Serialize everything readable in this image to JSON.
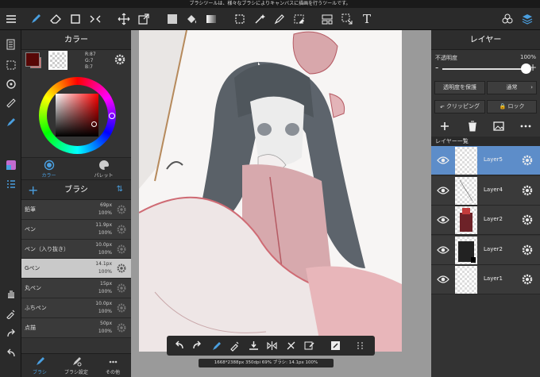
{
  "status": {
    "message": "ブラシツールは、様々なブラシによりキャンバスに描画を行うツールです。"
  },
  "toolbar": {
    "left_icons": [
      "menu-icon",
      "brush-icon",
      "eraser-icon",
      "rect-icon",
      "transform-icon"
    ],
    "mid_icons": [
      "move-icon",
      "resize-icon",
      "fill-color-icon",
      "bucket-icon",
      "gradient-icon",
      "select-rect-icon",
      "magic-wand-icon",
      "select-pen-icon",
      "select-eraser-icon",
      "ruler-icon",
      "select-move-icon",
      "text-icon"
    ],
    "right_icons": [
      "material-icon",
      "layer-stack-icon"
    ],
    "text_tool_glyph": "T"
  },
  "color_panel": {
    "title": "カラー",
    "main_color": "#570706",
    "rgb": {
      "r": "R:87",
      "g": "G:7",
      "b": "B:7"
    },
    "tabs": [
      {
        "label": "カラー"
      },
      {
        "label": "パレット"
      }
    ]
  },
  "brush_panel": {
    "title": "ブラシ",
    "brushes": [
      {
        "name": "鉛筆",
        "size": "69px",
        "opacity": "100%"
      },
      {
        "name": "ペン",
        "size": "11.9px",
        "opacity": "100%"
      },
      {
        "name": "ペン（入り抜き）",
        "size": "10.0px",
        "opacity": "100%"
      },
      {
        "name": "Gペン",
        "size": "14.1px",
        "opacity": "100%",
        "selected": true
      },
      {
        "name": "丸ペン",
        "size": "15px",
        "opacity": "100%"
      },
      {
        "name": "ふちペン",
        "size": "10.0px",
        "opacity": "100%"
      },
      {
        "name": "点描",
        "size": "50px",
        "opacity": "100%"
      }
    ],
    "tabs": [
      {
        "label": "ブラシ"
      },
      {
        "label": "ブラシ設定"
      },
      {
        "label": "その他"
      }
    ]
  },
  "canvas": {
    "info": "1668*2388px 350dpi 69% ブラシ: 14.1px 100%"
  },
  "layer_panel": {
    "title": "レイヤー",
    "opacity_label": "不透明度",
    "opacity_value": "100%",
    "opacity_fraction": 1.0,
    "minus": "-",
    "plus": "+",
    "protect_label": "透明度を保護",
    "blend_label": "通常",
    "clipping_label": "クリッピング",
    "lock_label": "ロック",
    "list_title": "レイヤー一覧",
    "layers": [
      {
        "name": "Layer5",
        "selected": true
      },
      {
        "name": "Layer4"
      },
      {
        "name": "Layer2"
      },
      {
        "name": "Layer2"
      },
      {
        "name": "Layer1"
      }
    ]
  }
}
